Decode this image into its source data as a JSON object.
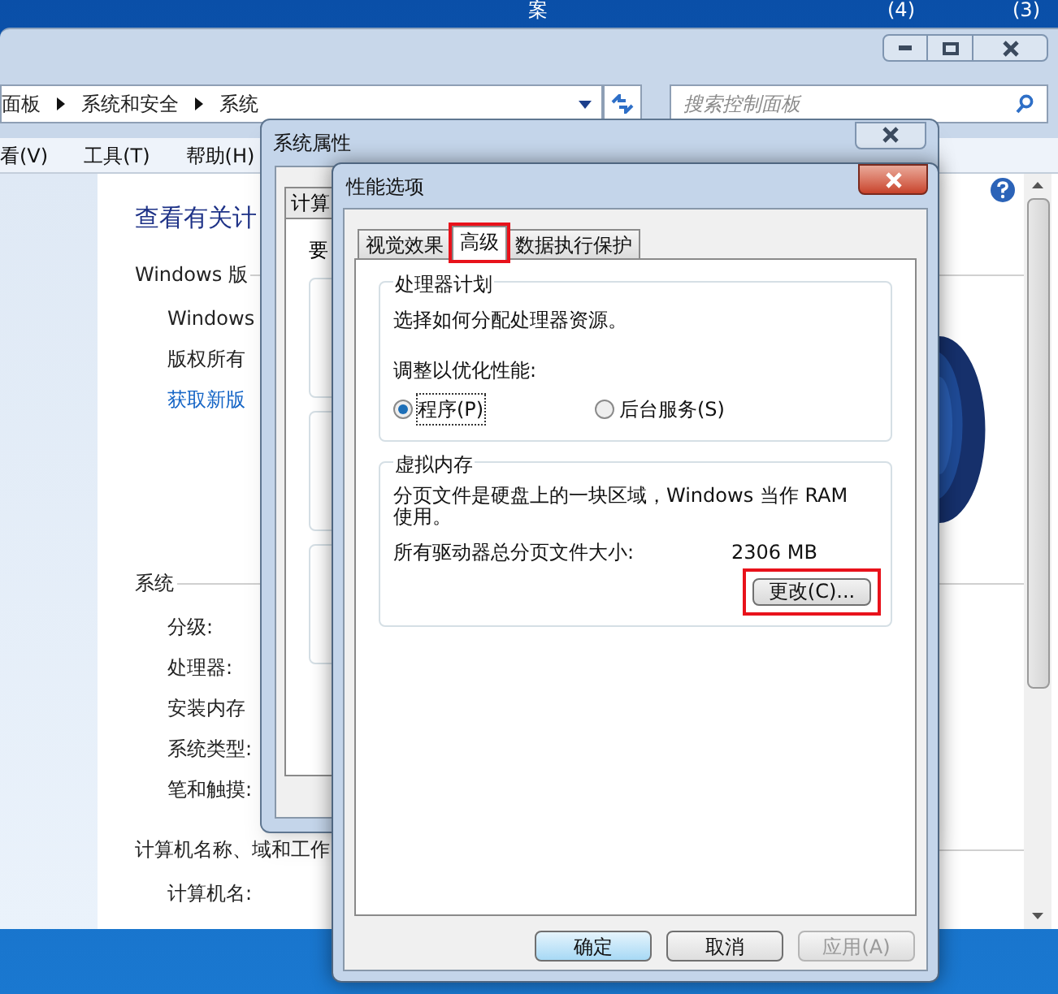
{
  "desktop": {
    "labels": [
      "案",
      "(4)",
      "(3)"
    ]
  },
  "control_panel": {
    "breadcrumb": [
      "面板",
      "系统和安全",
      "系统"
    ],
    "search": {
      "placeholder": "搜索控制面板"
    },
    "menu": [
      "看(V)",
      "工具(T)",
      "帮助(H)"
    ],
    "heading": "查看有关计",
    "groups": [
      {
        "title": "Windows 版",
        "items": [
          {
            "kind": "text",
            "text": "Windows"
          },
          {
            "kind": "text",
            "text": "版权所有"
          },
          {
            "kind": "link",
            "text": "获取新版"
          }
        ]
      },
      {
        "title": "系统",
        "items": [
          {
            "kind": "text",
            "text": "分级:"
          },
          {
            "kind": "text",
            "text": "处理器:"
          },
          {
            "kind": "text",
            "text": "安装内存"
          },
          {
            "kind": "text",
            "text": "系统类型:"
          },
          {
            "kind": "text",
            "text": "笔和触摸:"
          }
        ]
      },
      {
        "title": "计算机名称、域和工作",
        "items": [
          {
            "kind": "text",
            "text": "计算机名:"
          }
        ]
      }
    ]
  },
  "system_properties": {
    "title": "系统属性",
    "tabs": [
      {
        "label": "计算",
        "selected": false
      }
    ],
    "intro": "要"
  },
  "performance_options": {
    "title": "性能选项",
    "tabs": [
      {
        "label": "视觉效果",
        "selected": false,
        "highlighted": false
      },
      {
        "label": "高级",
        "selected": true,
        "highlighted": true
      },
      {
        "label": "数据执行保护",
        "selected": false,
        "highlighted": false
      }
    ],
    "processor": {
      "title": "处理器计划",
      "description": "选择如何分配处理器资源。",
      "adjust_label": "调整以优化性能:",
      "options": [
        {
          "label": "程序(P)",
          "selected": true
        },
        {
          "label": "后台服务(S)",
          "selected": false
        }
      ]
    },
    "virtual_memory": {
      "title": "虚拟内存",
      "description": "分页文件是硬盘上的一块区域，Windows 当作 RAM 使用。",
      "total_label": "所有驱动器总分页文件大小:",
      "total_value": "2306 MB",
      "change_button": {
        "label": "更改(C)...",
        "highlighted": true
      }
    },
    "buttons": [
      {
        "label": "确定",
        "kind": "default",
        "disabled": false
      },
      {
        "label": "取消",
        "kind": "normal",
        "disabled": false
      },
      {
        "label": "应用(A)",
        "kind": "normal",
        "disabled": true
      }
    ]
  }
}
